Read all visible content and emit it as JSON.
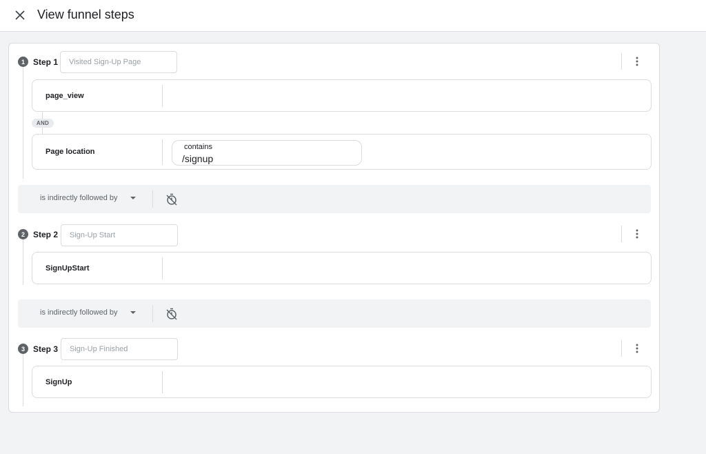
{
  "header": {
    "title": "View funnel steps",
    "close_icon": "close-icon"
  },
  "colors": {
    "background": "#f1f3f4",
    "card": "#ffffff",
    "border": "#dadce0",
    "badge": "#5f6368",
    "muted_text": "#5f6368",
    "placeholder": "#9aa0a6"
  },
  "steps": [
    {
      "number": "1",
      "label": "Step 1",
      "name_value": "",
      "name_placeholder": "Visited Sign-Up Page",
      "conditions": [
        {
          "name": "page_view"
        },
        {
          "name": "Page location",
          "operator": "contains",
          "value": "/signup"
        }
      ],
      "connector": "AND"
    },
    {
      "number": "2",
      "label": "Step 2",
      "name_value": "",
      "name_placeholder": "Sign-Up Start",
      "conditions": [
        {
          "name": "SignUpStart"
        }
      ]
    },
    {
      "number": "3",
      "label": "Step 3",
      "name_value": "",
      "name_placeholder": "Sign-Up Finished",
      "conditions": [
        {
          "name": "SignUp"
        }
      ]
    }
  ],
  "followers": [
    {
      "label": "is indirectly followed by",
      "timer_icon": "timer-off-icon"
    },
    {
      "label": "is indirectly followed by",
      "timer_icon": "timer-off-icon"
    }
  ]
}
